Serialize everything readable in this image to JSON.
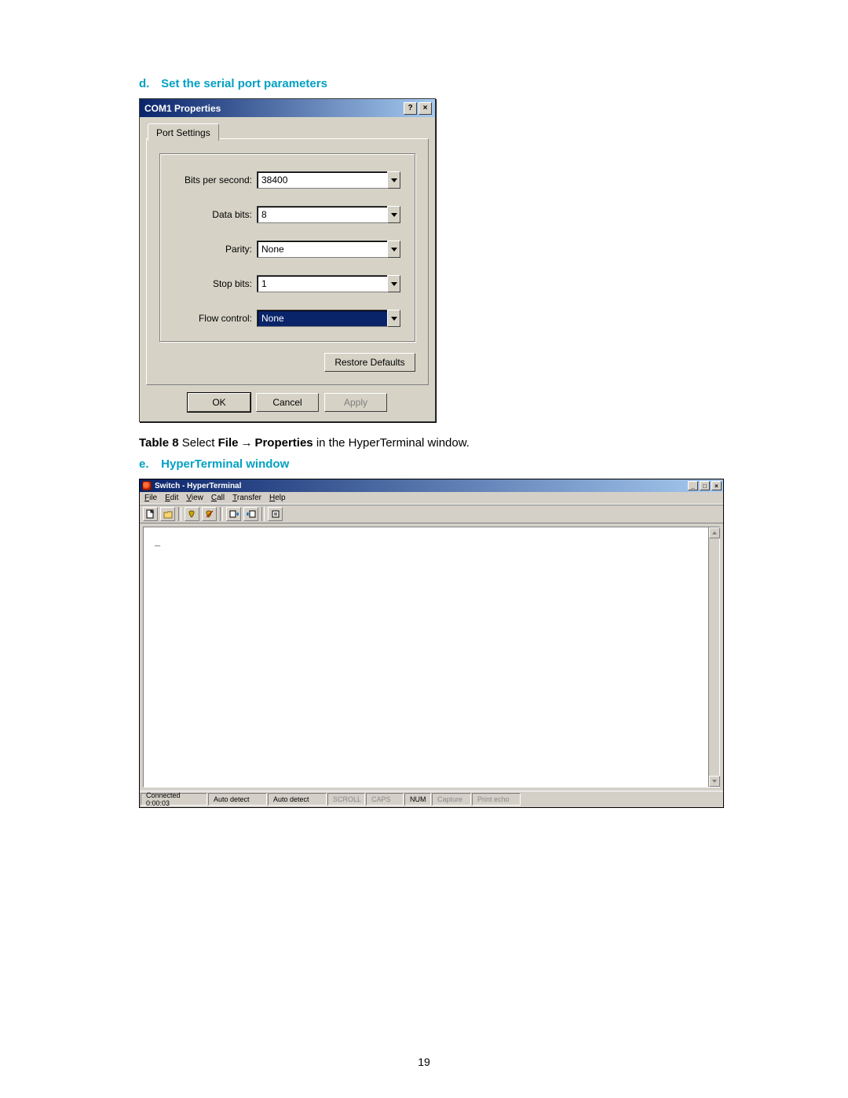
{
  "headings": {
    "d_prefix": "d.",
    "d_text": "Set the serial port parameters",
    "e_prefix": "e.",
    "e_text": "HyperTerminal window"
  },
  "caption": {
    "label": "Table 8",
    "pre": " Select ",
    "strong1": "File",
    "arrow": "→",
    "strong2": "Properties",
    "post": " in the HyperTerminal window."
  },
  "com1_dialog": {
    "title": "COM1 Properties",
    "help_btn": "?",
    "close_btn": "×",
    "tab_label": "Port Settings",
    "fields": {
      "bits_per_second": {
        "label": "Bits per second:",
        "value": "38400"
      },
      "data_bits": {
        "label": "Data bits:",
        "value": "8"
      },
      "parity": {
        "label": "Parity:",
        "value": "None"
      },
      "stop_bits": {
        "label": "Stop bits:",
        "value": "1"
      },
      "flow_control": {
        "label": "Flow control:",
        "value": "None"
      }
    },
    "restore_btn": "Restore Defaults",
    "ok_btn": "OK",
    "cancel_btn": "Cancel",
    "apply_btn": "Apply"
  },
  "ht_window": {
    "title": "Switch - HyperTerminal",
    "min_btn": "_",
    "max_btn": "□",
    "close_btn": "×",
    "menus": [
      "File",
      "Edit",
      "View",
      "Call",
      "Transfer",
      "Help"
    ],
    "status": {
      "connected": "Connected 0:00:03",
      "auto1": "Auto detect",
      "auto2": "Auto detect",
      "scroll": "SCROLL",
      "caps": "CAPS",
      "num": "NUM",
      "capture": "Capture",
      "echo": "Print echo"
    },
    "terminal_cursor": "_"
  },
  "page_number": "19"
}
